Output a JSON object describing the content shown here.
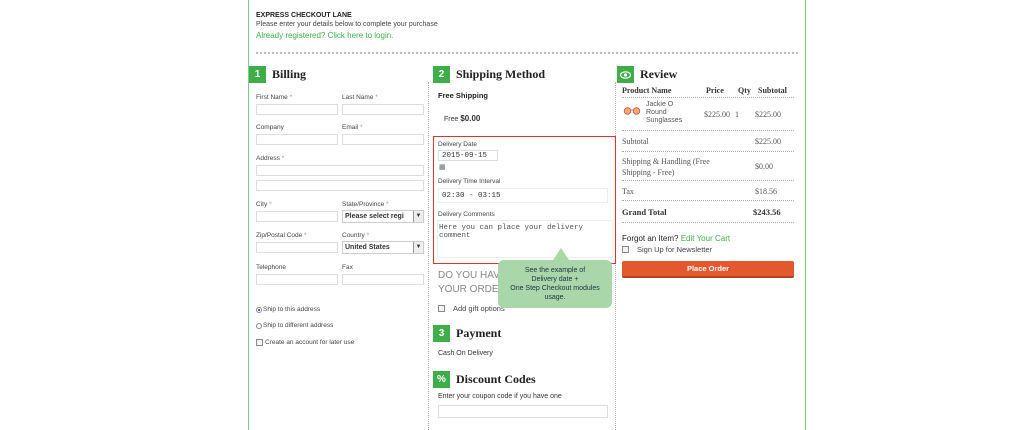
{
  "header": {
    "title": "EXPRESS CHECKOUT LANE",
    "subtitle": "Please enter your details below to complete your purchase",
    "login_link": "Already registered? Click here to login."
  },
  "billing": {
    "number": "1",
    "title": "Billing",
    "first_name": "First Name",
    "last_name": "Last Name",
    "company": "Company",
    "email": "Email",
    "address": "Address",
    "city": "City",
    "state": "State/Province",
    "state_value": "Please select regi",
    "zip": "Zip/Postal Code",
    "country": "Country",
    "country_value": "United States",
    "telephone": "Telephone",
    "fax": "Fax",
    "ship_this": "Ship to this address",
    "ship_diff": "Ship to different address",
    "create_account": "Create an account for later use",
    "req": "*"
  },
  "shipping": {
    "number": "2",
    "title": "Shipping Method",
    "method": "Free Shipping",
    "free_label": "Free",
    "free_price": "$0.00",
    "delivery_date_label": "Delivery Date",
    "delivery_date_value": "2015-09-15",
    "time_label": "Delivery Time Interval",
    "time_value": "02:30 - 03:15",
    "comments_label": "Delivery Comments",
    "comments_placeholder": "Here you can place your delivery comment",
    "gift_heading_1": "DO YOU HAV",
    "gift_heading_2": "YOUR ORDER",
    "gift_options": "Add gift options"
  },
  "tooltip": {
    "line1": "See the example of",
    "line2": "Delivery date +",
    "line3": "One Step Checkout modules",
    "line4": "usage."
  },
  "payment": {
    "number": "3",
    "title": "Payment",
    "method": "Cash On Delivery"
  },
  "discount": {
    "icon": "%",
    "title": "Discount Codes",
    "prompt": "Enter your coupon code if you have one"
  },
  "review": {
    "title": "Review",
    "headers": [
      "Product Name",
      "Price",
      "Qty",
      "Subtotal"
    ],
    "product_line1": "Jackie O",
    "product_line2": "Round",
    "product_line3": "Sunglasses",
    "price": "$225.00",
    "qty": "1",
    "subtotal": "$225.00",
    "subtotal_label": "Subtotal",
    "subtotal_value": "$225.00",
    "shipping_label_1": "Shipping & Handling (Free",
    "shipping_label_2": "Shipping - Free)",
    "shipping_value": "$0.00",
    "tax_label": "Tax",
    "tax_value": "$18.56",
    "grand_label": "Grand Total",
    "grand_value": "$243.56",
    "forgot": "Forgot an Item?",
    "edit_cart": "Edit Your Cart",
    "newsletter": "Sign Up for Newsletter",
    "place_order": "Place Order"
  },
  "colors": {
    "accent": "#3fae49",
    "order_button": "#e4582e",
    "highlight_border": "#dd3333",
    "tooltip_bg": "#a9d7a9"
  }
}
